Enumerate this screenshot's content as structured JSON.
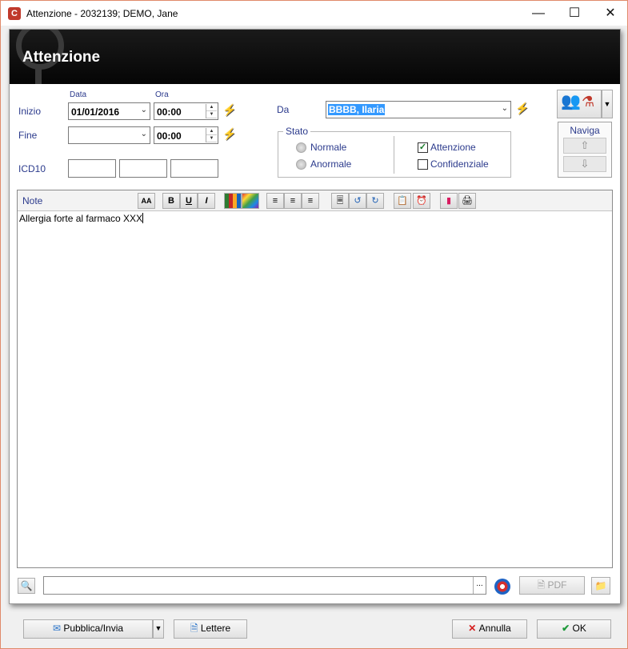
{
  "window": {
    "title": "Attenzione - 2032139; DEMO, Jane",
    "app_icon": "C",
    "minimize": "—",
    "maximize": "☐",
    "close": "✕"
  },
  "dialog": {
    "header_title": "Attenzione",
    "col_data": "Data",
    "col_ora": "Ora",
    "inizio": {
      "label": "Inizio",
      "date": "01/01/2016",
      "time": "00:00"
    },
    "fine": {
      "label": "Fine",
      "date": "",
      "time": "00:00"
    },
    "icd10": {
      "label": "ICD10",
      "fields": [
        "",
        "",
        ""
      ]
    },
    "da": {
      "label": "Da",
      "value": "BBBB, Ilaria"
    },
    "stato": {
      "title": "Stato",
      "radios": [
        {
          "label": "Normale",
          "checked": false
        },
        {
          "label": "Anormale",
          "checked": false
        }
      ],
      "checkboxes": [
        {
          "label": "Attenzione",
          "checked": true
        },
        {
          "label": "Confidenziale",
          "checked": false
        }
      ]
    },
    "naviga": {
      "label": "Naviga",
      "up": "⇧",
      "down": "⇩"
    },
    "note": {
      "label": "Note",
      "text": "Allergia forte al farmaco XXX",
      "toolbar_icons": [
        "font-size-icon",
        "bold-icon",
        "underline-icon",
        "italic-icon",
        "pencils-icon",
        "color-palette-icon",
        "align-left-icon",
        "align-center-icon",
        "align-right-icon",
        "page-icon",
        "undo-icon",
        "redo-icon",
        "clipboard-icon",
        "clock-icon",
        "eraser-icon",
        "printer-icon"
      ],
      "bold": "B",
      "underline": "U",
      "italic": "I",
      "font_glyph": "AA"
    },
    "pdf_label": "PDF",
    "ellipsis": "..."
  },
  "footer": {
    "publish_label": "Pubblica/Invia",
    "lettere_label": "Lettere",
    "annulla_label": "Annulla",
    "ok_label": "OK"
  },
  "colors": {
    "label_blue": "#2b3a8c",
    "header_bg": "#0b0b0b",
    "selection_blue": "#3399ff",
    "cancel_red": "#d62020",
    "ok_green": "#1f9a3a"
  }
}
